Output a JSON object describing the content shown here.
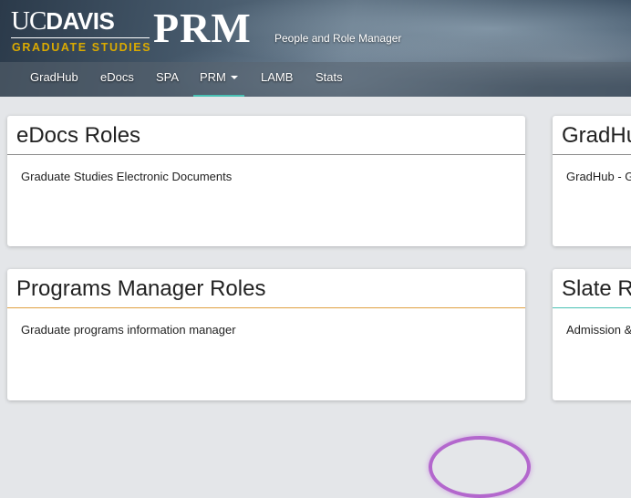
{
  "brand": {
    "uc": "UC",
    "davis": "DAVIS",
    "graduate_studies": "GRADUATE STUDIES",
    "app_name": "PRM",
    "app_subtitle": "People and Role Manager"
  },
  "nav": {
    "items": [
      {
        "label": "GradHub"
      },
      {
        "label": "eDocs"
      },
      {
        "label": "SPA"
      },
      {
        "label": "PRM",
        "active": true,
        "dropdown": true
      },
      {
        "label": "LAMB"
      },
      {
        "label": "Stats"
      }
    ]
  },
  "cards": [
    {
      "title": "eDocs Roles",
      "description": "Graduate Studies Electronic Documents",
      "accent": "#8a8a8a"
    },
    {
      "title": "GradHub",
      "description": "GradHub - G",
      "accent": "#8a8a8a"
    },
    {
      "title": "Programs Manager Roles",
      "description": "Graduate programs information manager",
      "accent": "#e0a040"
    },
    {
      "title": "Slate R",
      "description": "Admission &",
      "accent": "#48c0b3"
    }
  ],
  "colors": {
    "gold": "#daaa00",
    "nav_active_underline": "#48c0b3"
  }
}
